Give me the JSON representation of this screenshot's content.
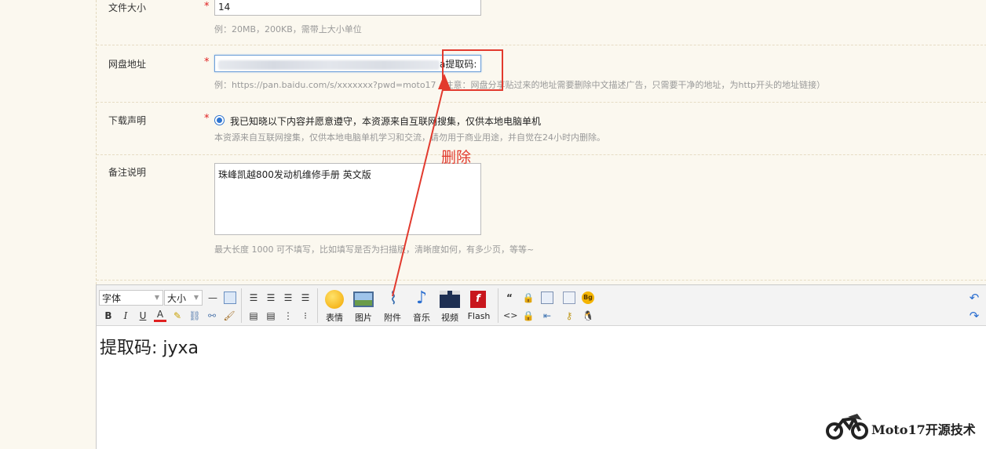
{
  "form": {
    "file_size": {
      "label": "文件大小",
      "required_mark": "*",
      "value": "14",
      "hint": "例：20MB，200KB，需带上大小单位"
    },
    "disk_url": {
      "label": "网盘地址",
      "required_mark": "*",
      "value_suffix": "a提取码:",
      "hint": "例：https://pan.baidu.com/s/xxxxxxx?pwd=moto17（注意：网盘分享贴过来的地址需要删除中文描述广告，只需要干净的地址，为http开头的地址链接）"
    },
    "download_notice": {
      "label": "下载声明",
      "required_mark": "*",
      "option": "我已知晓以下内容并愿意遵守，本资源来自互联网搜集，仅供本地电脑单机",
      "hint": "本资源来自互联网搜集，仅供本地电脑单机学习和交流，请勿用于商业用途，并自觉在24小时内删除。"
    },
    "remark": {
      "label": "备注说明",
      "value": "珠峰凯越800发动机维修手册 英文版",
      "hint": "最大长度 1000  可不填写，比如填写是否为扫描版，清晰度如何，有多少页，等等~"
    }
  },
  "editor": {
    "font_select": "字体",
    "size_select": "大小",
    "buttons": {
      "emoticon": "表情",
      "image": "图片",
      "attachment": "附件",
      "music": "音乐",
      "video": "视频",
      "flash": "Flash"
    },
    "format_labels": {
      "bold": "B",
      "italic": "I",
      "underline": "U",
      "font_color": "A",
      "quote": "“",
      "code": "<>"
    },
    "content": "提取码: jyxa"
  },
  "annotation": {
    "text": "删除",
    "color": "#e23a2e"
  },
  "watermark": {
    "text": "Moto17开源技术"
  }
}
